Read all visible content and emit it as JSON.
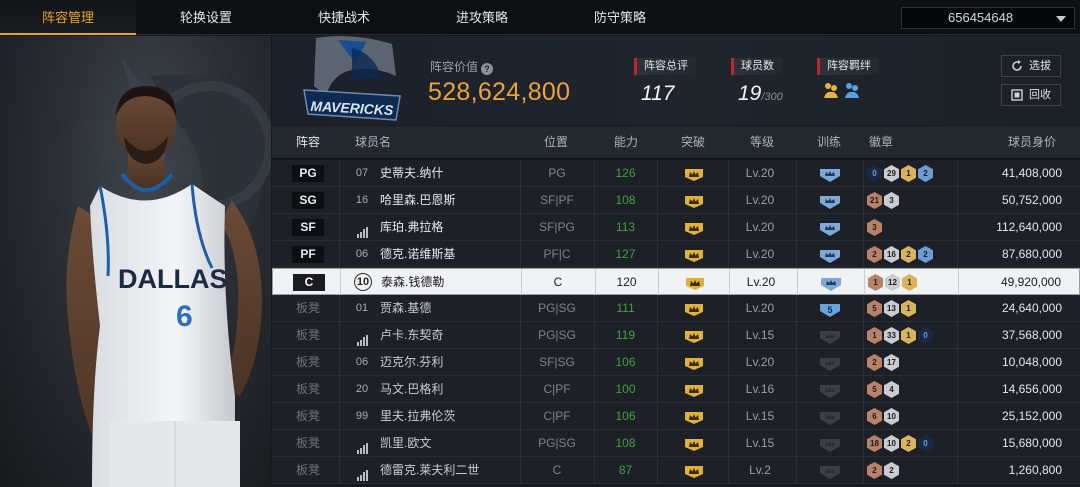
{
  "tabs": [
    {
      "label": "阵容管理",
      "active": true
    },
    {
      "label": "轮换设置",
      "active": false
    },
    {
      "label": "快捷战术",
      "active": false
    },
    {
      "label": "进攻策略",
      "active": false
    },
    {
      "label": "防守策略",
      "active": false
    }
  ],
  "account": {
    "id": "656454648"
  },
  "player_card": {
    "team_text": "DALLAS",
    "number": "6"
  },
  "team": {
    "logo_text": "MAVERICKS"
  },
  "summary": {
    "value_label": "阵容价值",
    "value": "528,624,800",
    "rating_label": "阵容总评",
    "rating": "117",
    "players_label": "球员数",
    "players": "19",
    "players_max": "/300",
    "bonds_label": "阵容羁绊"
  },
  "buttons": {
    "select": "选拔",
    "recycle": "回收"
  },
  "columns": {
    "lineup": "阵容",
    "name": "球员名",
    "position": "位置",
    "ability": "能力",
    "breakthrough": "突破",
    "level": "等级",
    "training": "训练",
    "badges": "徽章",
    "salary": "球员身价"
  },
  "rows": [
    {
      "slot": "PG",
      "starter": true,
      "jersey": "07",
      "name": "史蒂夫.纳什",
      "position": "PG",
      "ability": "126",
      "level": "Lv.20",
      "train": "bluecrown",
      "badges": [
        {
          "t": "dk",
          "v": "0"
        },
        {
          "t": "si",
          "v": "29"
        },
        {
          "t": "go",
          "v": "1"
        },
        {
          "t": "bl",
          "v": "2"
        }
      ],
      "salary": "41,408,000"
    },
    {
      "slot": "SG",
      "starter": true,
      "jersey": "16",
      "name": "哈里森.巴恩斯",
      "position": "SF|PF",
      "ability": "108",
      "level": "Lv.20",
      "train": "bluecrown",
      "badges": [
        {
          "t": "br",
          "v": "21"
        },
        {
          "t": "si",
          "v": "3"
        }
      ],
      "salary": "50,752,000"
    },
    {
      "slot": "SF",
      "starter": true,
      "jersey": "bars",
      "name": "库珀.弗拉格",
      "position": "SF|PG",
      "ability": "113",
      "level": "Lv.20",
      "train": "bluecrown",
      "badges": [
        {
          "t": "br",
          "v": "3"
        }
      ],
      "salary": "112,640,000"
    },
    {
      "slot": "PF",
      "starter": true,
      "jersey": "06",
      "name": "德克.诺维斯基",
      "position": "PF|C",
      "ability": "127",
      "level": "Lv.20",
      "train": "bluecrown",
      "badges": [
        {
          "t": "br",
          "v": "2"
        },
        {
          "t": "si",
          "v": "16"
        },
        {
          "t": "go",
          "v": "2"
        },
        {
          "t": "bl",
          "v": "2"
        }
      ],
      "salary": "87,680,000"
    },
    {
      "slot": "C",
      "starter": true,
      "selected": true,
      "jersey": "10",
      "name": "泰森.钱德勒",
      "position": "C",
      "ability": "120",
      "level": "Lv.20",
      "train": "bluecrown",
      "badges": [
        {
          "t": "br",
          "v": "1"
        },
        {
          "t": "si",
          "v": "12"
        },
        {
          "t": "go",
          "v": "1"
        }
      ],
      "salary": "49,920,000"
    },
    {
      "slot": "板凳",
      "starter": false,
      "jersey": "01",
      "name": "贾森.基德",
      "position": "PG|SG",
      "ability": "111",
      "level": "Lv.20",
      "train": "blue5",
      "badges": [
        {
          "t": "br",
          "v": "5"
        },
        {
          "t": "si",
          "v": "13"
        },
        {
          "t": "go",
          "v": "1"
        }
      ],
      "salary": "24,640,000"
    },
    {
      "slot": "板凳",
      "starter": false,
      "jersey": "bars",
      "name": "卢卡.东契奇",
      "position": "PG|SG",
      "ability": "119",
      "level": "Lv.15",
      "train": "grey",
      "badges": [
        {
          "t": "br",
          "v": "1"
        },
        {
          "t": "si",
          "v": "33"
        },
        {
          "t": "go",
          "v": "1"
        },
        {
          "t": "dk",
          "v": "0"
        }
      ],
      "salary": "37,568,000"
    },
    {
      "slot": "板凳",
      "starter": false,
      "jersey": "06",
      "name": "迈克尔.芬利",
      "position": "SF|SG",
      "ability": "106",
      "level": "Lv.20",
      "train": "grey",
      "badges": [
        {
          "t": "br",
          "v": "2"
        },
        {
          "t": "si",
          "v": "17"
        }
      ],
      "salary": "10,048,000"
    },
    {
      "slot": "板凳",
      "starter": false,
      "jersey": "20",
      "name": "马文.巴格利",
      "position": "C|PF",
      "ability": "100",
      "level": "Lv.16",
      "train": "grey",
      "badges": [
        {
          "t": "br",
          "v": "5"
        },
        {
          "t": "si",
          "v": "4"
        }
      ],
      "salary": "14,656,000"
    },
    {
      "slot": "板凳",
      "starter": false,
      "jersey": "99",
      "name": "里夫.拉弗伦茨",
      "position": "C|PF",
      "ability": "106",
      "level": "Lv.15",
      "train": "grey",
      "badges": [
        {
          "t": "br",
          "v": "6"
        },
        {
          "t": "si",
          "v": "10"
        }
      ],
      "salary": "25,152,000"
    },
    {
      "slot": "板凳",
      "starter": false,
      "jersey": "bars",
      "name": "凯里.欧文",
      "position": "PG|SG",
      "ability": "108",
      "level": "Lv.15",
      "train": "grey",
      "badges": [
        {
          "t": "br",
          "v": "18"
        },
        {
          "t": "si",
          "v": "10"
        },
        {
          "t": "go",
          "v": "2"
        },
        {
          "t": "dk",
          "v": "0"
        }
      ],
      "salary": "15,680,000"
    },
    {
      "slot": "板凳",
      "starter": false,
      "jersey": "bars",
      "name": "德雷克.莱夫利二世",
      "position": "C",
      "ability": "87",
      "level": "Lv.2",
      "train": "grey",
      "badges": [
        {
          "t": "br",
          "v": "2"
        },
        {
          "t": "si",
          "v": "2"
        }
      ],
      "salary": "1,260,800"
    }
  ],
  "colors": {
    "accent": "#e6a52e",
    "value": "#eba33b",
    "ability": "#3fa33c",
    "stat_marker": "#c3262a"
  },
  "icons": {
    "crown": "crown-icon",
    "training": "training-icon",
    "bars": "signal-bars-icon",
    "help": "help-icon"
  }
}
